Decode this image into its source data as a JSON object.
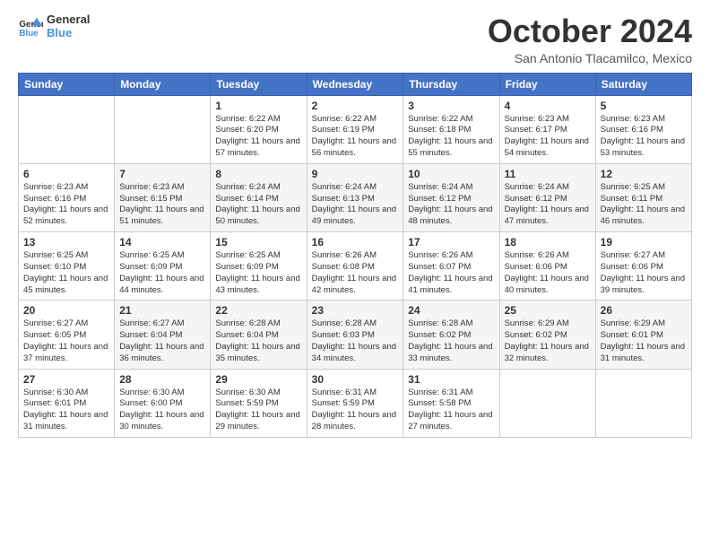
{
  "logo": {
    "line1": "General",
    "line2": "Blue"
  },
  "header": {
    "month": "October 2024",
    "location": "San Antonio Tlacamilco, Mexico"
  },
  "days_of_week": [
    "Sunday",
    "Monday",
    "Tuesday",
    "Wednesday",
    "Thursday",
    "Friday",
    "Saturday"
  ],
  "weeks": [
    [
      {
        "day": "",
        "sunrise": "",
        "sunset": "",
        "daylight": ""
      },
      {
        "day": "",
        "sunrise": "",
        "sunset": "",
        "daylight": ""
      },
      {
        "day": "1",
        "sunrise": "Sunrise: 6:22 AM",
        "sunset": "Sunset: 6:20 PM",
        "daylight": "Daylight: 11 hours and 57 minutes."
      },
      {
        "day": "2",
        "sunrise": "Sunrise: 6:22 AM",
        "sunset": "Sunset: 6:19 PM",
        "daylight": "Daylight: 11 hours and 56 minutes."
      },
      {
        "day": "3",
        "sunrise": "Sunrise: 6:22 AM",
        "sunset": "Sunset: 6:18 PM",
        "daylight": "Daylight: 11 hours and 55 minutes."
      },
      {
        "day": "4",
        "sunrise": "Sunrise: 6:23 AM",
        "sunset": "Sunset: 6:17 PM",
        "daylight": "Daylight: 11 hours and 54 minutes."
      },
      {
        "day": "5",
        "sunrise": "Sunrise: 6:23 AM",
        "sunset": "Sunset: 6:16 PM",
        "daylight": "Daylight: 11 hours and 53 minutes."
      }
    ],
    [
      {
        "day": "6",
        "sunrise": "Sunrise: 6:23 AM",
        "sunset": "Sunset: 6:16 PM",
        "daylight": "Daylight: 11 hours and 52 minutes."
      },
      {
        "day": "7",
        "sunrise": "Sunrise: 6:23 AM",
        "sunset": "Sunset: 6:15 PM",
        "daylight": "Daylight: 11 hours and 51 minutes."
      },
      {
        "day": "8",
        "sunrise": "Sunrise: 6:24 AM",
        "sunset": "Sunset: 6:14 PM",
        "daylight": "Daylight: 11 hours and 50 minutes."
      },
      {
        "day": "9",
        "sunrise": "Sunrise: 6:24 AM",
        "sunset": "Sunset: 6:13 PM",
        "daylight": "Daylight: 11 hours and 49 minutes."
      },
      {
        "day": "10",
        "sunrise": "Sunrise: 6:24 AM",
        "sunset": "Sunset: 6:12 PM",
        "daylight": "Daylight: 11 hours and 48 minutes."
      },
      {
        "day": "11",
        "sunrise": "Sunrise: 6:24 AM",
        "sunset": "Sunset: 6:12 PM",
        "daylight": "Daylight: 11 hours and 47 minutes."
      },
      {
        "day": "12",
        "sunrise": "Sunrise: 6:25 AM",
        "sunset": "Sunset: 6:11 PM",
        "daylight": "Daylight: 11 hours and 46 minutes."
      }
    ],
    [
      {
        "day": "13",
        "sunrise": "Sunrise: 6:25 AM",
        "sunset": "Sunset: 6:10 PM",
        "daylight": "Daylight: 11 hours and 45 minutes."
      },
      {
        "day": "14",
        "sunrise": "Sunrise: 6:25 AM",
        "sunset": "Sunset: 6:09 PM",
        "daylight": "Daylight: 11 hours and 44 minutes."
      },
      {
        "day": "15",
        "sunrise": "Sunrise: 6:25 AM",
        "sunset": "Sunset: 6:09 PM",
        "daylight": "Daylight: 11 hours and 43 minutes."
      },
      {
        "day": "16",
        "sunrise": "Sunrise: 6:26 AM",
        "sunset": "Sunset: 6:08 PM",
        "daylight": "Daylight: 11 hours and 42 minutes."
      },
      {
        "day": "17",
        "sunrise": "Sunrise: 6:26 AM",
        "sunset": "Sunset: 6:07 PM",
        "daylight": "Daylight: 11 hours and 41 minutes."
      },
      {
        "day": "18",
        "sunrise": "Sunrise: 6:26 AM",
        "sunset": "Sunset: 6:06 PM",
        "daylight": "Daylight: 11 hours and 40 minutes."
      },
      {
        "day": "19",
        "sunrise": "Sunrise: 6:27 AM",
        "sunset": "Sunset: 6:06 PM",
        "daylight": "Daylight: 11 hours and 39 minutes."
      }
    ],
    [
      {
        "day": "20",
        "sunrise": "Sunrise: 6:27 AM",
        "sunset": "Sunset: 6:05 PM",
        "daylight": "Daylight: 11 hours and 37 minutes."
      },
      {
        "day": "21",
        "sunrise": "Sunrise: 6:27 AM",
        "sunset": "Sunset: 6:04 PM",
        "daylight": "Daylight: 11 hours and 36 minutes."
      },
      {
        "day": "22",
        "sunrise": "Sunrise: 6:28 AM",
        "sunset": "Sunset: 6:04 PM",
        "daylight": "Daylight: 11 hours and 35 minutes."
      },
      {
        "day": "23",
        "sunrise": "Sunrise: 6:28 AM",
        "sunset": "Sunset: 6:03 PM",
        "daylight": "Daylight: 11 hours and 34 minutes."
      },
      {
        "day": "24",
        "sunrise": "Sunrise: 6:28 AM",
        "sunset": "Sunset: 6:02 PM",
        "daylight": "Daylight: 11 hours and 33 minutes."
      },
      {
        "day": "25",
        "sunrise": "Sunrise: 6:29 AM",
        "sunset": "Sunset: 6:02 PM",
        "daylight": "Daylight: 11 hours and 32 minutes."
      },
      {
        "day": "26",
        "sunrise": "Sunrise: 6:29 AM",
        "sunset": "Sunset: 6:01 PM",
        "daylight": "Daylight: 11 hours and 31 minutes."
      }
    ],
    [
      {
        "day": "27",
        "sunrise": "Sunrise: 6:30 AM",
        "sunset": "Sunset: 6:01 PM",
        "daylight": "Daylight: 11 hours and 31 minutes."
      },
      {
        "day": "28",
        "sunrise": "Sunrise: 6:30 AM",
        "sunset": "Sunset: 6:00 PM",
        "daylight": "Daylight: 11 hours and 30 minutes."
      },
      {
        "day": "29",
        "sunrise": "Sunrise: 6:30 AM",
        "sunset": "Sunset: 5:59 PM",
        "daylight": "Daylight: 11 hours and 29 minutes."
      },
      {
        "day": "30",
        "sunrise": "Sunrise: 6:31 AM",
        "sunset": "Sunset: 5:59 PM",
        "daylight": "Daylight: 11 hours and 28 minutes."
      },
      {
        "day": "31",
        "sunrise": "Sunrise: 6:31 AM",
        "sunset": "Sunset: 5:58 PM",
        "daylight": "Daylight: 11 hours and 27 minutes."
      },
      {
        "day": "",
        "sunrise": "",
        "sunset": "",
        "daylight": ""
      },
      {
        "day": "",
        "sunrise": "",
        "sunset": "",
        "daylight": ""
      }
    ]
  ]
}
